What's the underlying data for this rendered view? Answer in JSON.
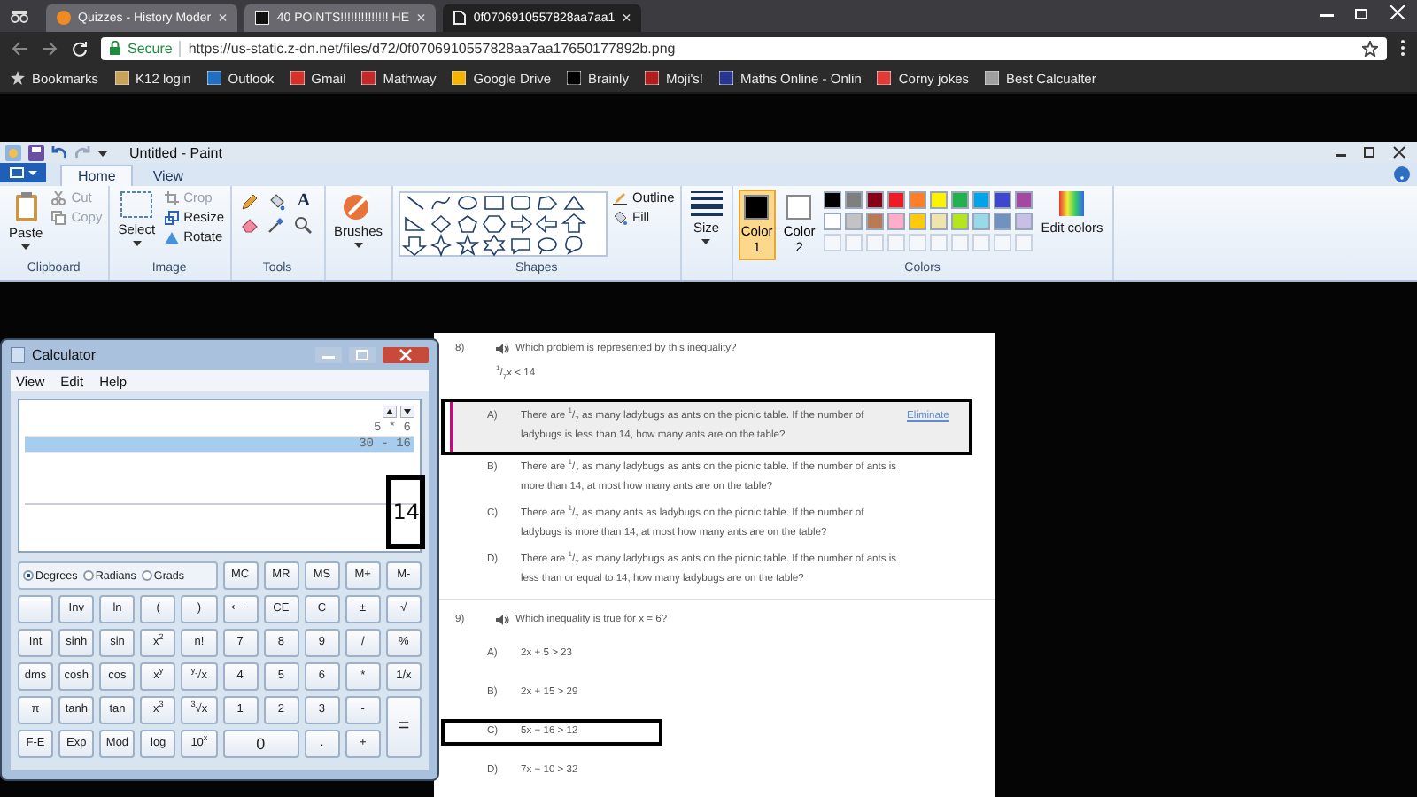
{
  "browser": {
    "tabs": [
      {
        "kind": "quiz",
        "title": "Quizzes - History Moder",
        "close": "×",
        "selected": false
      },
      {
        "kind": "brainly",
        "title": "40 POINTS!!!!!!!!!!!!!! HE",
        "close": "×",
        "selected": false
      },
      {
        "kind": "page",
        "title": "0f0706910557828aa7aa1",
        "close": "×",
        "selected": true
      }
    ],
    "secure_label": "Secure",
    "url": "https://us-static.z-dn.net/files/d72/0f0706910557828aa7aa17650177892b.png",
    "bookmarks": [
      {
        "kind": "star",
        "label": "Bookmarks"
      },
      {
        "kind": "site",
        "label": "K12 login",
        "color": "#c9a25a"
      },
      {
        "kind": "site",
        "label": "Outlook",
        "color": "#1f6fc5"
      },
      {
        "kind": "site",
        "label": "Gmail",
        "color": "#d93025"
      },
      {
        "kind": "site",
        "label": "Mathway",
        "color": "#c62828"
      },
      {
        "kind": "site",
        "label": "Google Drive",
        "color": "#f4b400"
      },
      {
        "kind": "site",
        "label": "Brainly",
        "color": "#000000"
      },
      {
        "kind": "site",
        "label": "Moji's!",
        "color": "#b71c1c"
      },
      {
        "kind": "site",
        "label": "Maths Online - Onlin",
        "color": "#283593"
      },
      {
        "kind": "site",
        "label": "Corny jokes",
        "color": "#e53935"
      },
      {
        "kind": "site",
        "label": "Best Calcualter",
        "color": "#9e9e9e"
      }
    ]
  },
  "paint": {
    "title": "Untitled - Paint",
    "tabs": [
      {
        "label": "Home",
        "selected": true
      },
      {
        "label": "View",
        "selected": false
      }
    ],
    "groups": [
      {
        "kind": "clipboard",
        "label": "Clipboard",
        "paste": "Paste",
        "cut": {
          "label": "Cut",
          "disabled": true
        },
        "copy": {
          "label": "Copy",
          "disabled": true
        }
      },
      {
        "kind": "image",
        "label": "Image",
        "select": "Select",
        "crop": {
          "label": "Crop",
          "disabled": true
        },
        "resize": {
          "label": "Resize",
          "disabled": false
        },
        "rotate": {
          "label": "Rotate",
          "disabled": false
        }
      },
      {
        "kind": "tools",
        "label": "Tools",
        "text_tool": "A"
      },
      {
        "kind": "brushes",
        "brushes": "Brushes"
      },
      {
        "kind": "shapes",
        "label": "Shapes",
        "outline": "Outline",
        "fill": "Fill"
      },
      {
        "kind": "size",
        "size": "Size"
      },
      {
        "kind": "colors",
        "label": "Colors",
        "color1": {
          "label": "Color 1",
          "selected": true
        },
        "color2": {
          "label": "Color 2",
          "selected": false
        },
        "edit": "Edit colors",
        "palette": [
          {
            "color": "#000000"
          },
          {
            "color": "#7f7f7f"
          },
          {
            "color": "#880015"
          },
          {
            "color": "#ed1c24"
          },
          {
            "color": "#ff7f27"
          },
          {
            "color": "#fff200"
          },
          {
            "color": "#22b14c"
          },
          {
            "color": "#00a2e8"
          },
          {
            "color": "#3f48cc"
          },
          {
            "color": "#a349a4"
          },
          {
            "color": "#ffffff"
          },
          {
            "color": "#c3c3c3"
          },
          {
            "color": "#b97a57"
          },
          {
            "color": "#ffaec9"
          },
          {
            "color": "#ffc90e"
          },
          {
            "color": "#efe4b0"
          },
          {
            "color": "#b5e61d"
          },
          {
            "color": "#99d9ea"
          },
          {
            "color": "#7092be"
          },
          {
            "color": "#c8bfe7"
          }
        ]
      }
    ]
  },
  "calculator": {
    "title": "Calculator",
    "menu": [
      "View",
      "Edit",
      "Help"
    ],
    "history": [
      {
        "text": "5 * 6",
        "selected": false
      },
      {
        "text": "30 - 16",
        "selected": true
      }
    ],
    "display": "14",
    "display_annotated": true,
    "angle_modes": [
      {
        "label": "Degrees",
        "selected": true
      },
      {
        "label": "Radians",
        "selected": false
      },
      {
        "label": "Grads",
        "selected": false
      }
    ],
    "memory_keys": [
      "MC",
      "MR",
      "MS",
      "M+",
      "M-"
    ],
    "keys": [
      {
        "kind": "blank"
      },
      {
        "kind": "key",
        "label": "Inv"
      },
      {
        "kind": "key",
        "label": "ln"
      },
      {
        "kind": "key",
        "label": "("
      },
      {
        "kind": "key",
        "label": ")"
      },
      {
        "kind": "key",
        "label": "⟵"
      },
      {
        "kind": "key",
        "label": "CE"
      },
      {
        "kind": "key",
        "label": "C"
      },
      {
        "kind": "key",
        "label": "±"
      },
      {
        "kind": "key",
        "label": "√"
      },
      {
        "kind": "key",
        "label": "Int"
      },
      {
        "kind": "key",
        "label": "sinh"
      },
      {
        "kind": "key",
        "label": "sin"
      },
      {
        "kind": "key",
        "label": "x$^{2}$"
      },
      {
        "kind": "key",
        "label": "n!"
      },
      {
        "kind": "key",
        "label": "7"
      },
      {
        "kind": "key",
        "label": "8"
      },
      {
        "kind": "key",
        "label": "9"
      },
      {
        "kind": "key",
        "label": "/"
      },
      {
        "kind": "key",
        "label": "%"
      },
      {
        "kind": "key",
        "label": "dms"
      },
      {
        "kind": "key",
        "label": "cosh"
      },
      {
        "kind": "key",
        "label": "cos"
      },
      {
        "kind": "key",
        "label": "x$^{y}$"
      },
      {
        "kind": "key",
        "label": "$^{y}$√x"
      },
      {
        "kind": "key",
        "label": "4"
      },
      {
        "kind": "key",
        "label": "5"
      },
      {
        "kind": "key",
        "label": "6"
      },
      {
        "kind": "key",
        "label": "*"
      },
      {
        "kind": "key",
        "label": "1/x"
      },
      {
        "kind": "key",
        "label": "π"
      },
      {
        "kind": "key",
        "label": "tanh"
      },
      {
        "kind": "key",
        "label": "tan"
      },
      {
        "kind": "key",
        "label": "x$^{3}$"
      },
      {
        "kind": "key",
        "label": "$^{3}$√x"
      },
      {
        "kind": "key",
        "label": "1"
      },
      {
        "kind": "key",
        "label": "2"
      },
      {
        "kind": "key",
        "label": "3"
      },
      {
        "kind": "key",
        "label": "-"
      },
      {
        "kind": "equals",
        "label": "="
      },
      {
        "kind": "key",
        "label": "F-E"
      },
      {
        "kind": "key",
        "label": "Exp"
      },
      {
        "kind": "key",
        "label": "Mod"
      },
      {
        "kind": "key",
        "label": "log"
      },
      {
        "kind": "key",
        "label": "10$^{x}$"
      },
      {
        "kind": "zero",
        "label": "0"
      },
      {
        "kind": "key",
        "label": "."
      },
      {
        "kind": "key",
        "label": "+"
      }
    ]
  },
  "questions": [
    {
      "number": "8)",
      "prompt": "Which problem is represented by this inequality?",
      "expression": "$^{1}$/$_{7}$x < 14",
      "options": [
        {
          "letter": "A)",
          "text": "There are $^{1}$/$_{7}$ as many ladybugs as ants on the picnic table. If the number of ladybugs is less than 14, how many ants are on the table?",
          "selected": true,
          "annotated": true,
          "action": "Eliminate"
        },
        {
          "letter": "B)",
          "text": "There are $^{1}$/$_{7}$ as many ladybugs as ants on the picnic table. If the number of ants is more than 14, at most how many ants are on the table?",
          "selected": false,
          "annotated": false
        },
        {
          "letter": "C)",
          "text": "There are $^{1}$/$_{7}$ as many ants as ladybugs on the picnic table. If the number of ladybugs is more than 14, at most how many ants are on the table?",
          "selected": false,
          "annotated": false
        },
        {
          "letter": "D)",
          "text": "There are $^{1}$/$_{7}$ as many ladybugs as ants on the picnic table. If the number of ants is less than or equal to 14, how many ladybugs are on the table?",
          "selected": false,
          "annotated": false
        }
      ]
    },
    {
      "number": "9)",
      "prompt": "Which inequality is true for x = 6?",
      "options": [
        {
          "letter": "A)",
          "text": "2x + 5 > 23",
          "selected": false,
          "annotated": false
        },
        {
          "letter": "B)",
          "text": "2x + 15 > 29",
          "selected": false,
          "annotated": false
        },
        {
          "letter": "C)",
          "text": "5x − 16 > 12",
          "selected": false,
          "annotated": true
        },
        {
          "letter": "D)",
          "text": "7x − 10 > 32",
          "selected": false,
          "annotated": false
        }
      ]
    }
  ]
}
